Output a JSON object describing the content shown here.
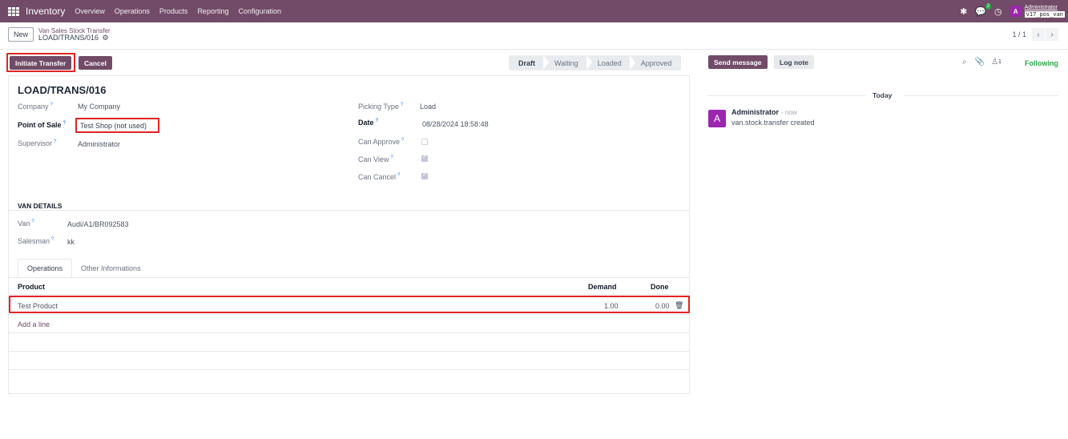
{
  "navbar": {
    "app_name": "Inventory",
    "menus": [
      "Overview",
      "Operations",
      "Products",
      "Reporting",
      "Configuration"
    ],
    "message_count": "2",
    "user_initial": "A",
    "user_name": "Administrator",
    "database": "v17_pos_van"
  },
  "control": {
    "new_label": "New",
    "breadcrumb_parent": "Van Sales Stock Transfer",
    "breadcrumb_current": "LOAD/TRANS/016",
    "pager": "1 / 1"
  },
  "actions": {
    "initiate_label": "Initiate Transfer",
    "cancel_label": "Cancel"
  },
  "status": {
    "stages": [
      "Draft",
      "Waiting",
      "Loaded",
      "Approved"
    ],
    "active": "Draft"
  },
  "form": {
    "title": "LOAD/TRANS/016",
    "company_label": "Company",
    "company_value": "My Company",
    "pos_label": "Point of Sale",
    "pos_value": "Test Shop (not used)",
    "supervisor_label": "Supervisor",
    "supervisor_value": "Administrator",
    "picking_type_label": "Picking Type",
    "picking_type_value": "Load",
    "date_label": "Date",
    "date_value": "08/28/2024 18:58:48",
    "can_approve_label": "Can Approve",
    "can_view_label": "Can View",
    "can_cancel_label": "Can Cancel",
    "help_mark": "?",
    "van_section": "VAN DETAILS",
    "van_label": "Van",
    "van_value": "Audi/A1/BR092583",
    "salesman_label": "Salesman",
    "salesman_value": "kk",
    "tabs": [
      "Operations",
      "Other Informations"
    ],
    "table": {
      "headers": [
        "Product",
        "Demand",
        "Done"
      ],
      "rows": [
        {
          "product": "Test Product",
          "demand": "1.00",
          "done": "0.00"
        }
      ],
      "add_line": "Add a line"
    }
  },
  "chatter": {
    "send_message": "Send message",
    "log_note": "Log note",
    "followers_count": "1",
    "following": "Following",
    "today": "Today",
    "author": "Administrator",
    "time": "- now",
    "body": "van.stock.transfer created",
    "avatar_initial": "A"
  },
  "colors": {
    "brand": "#714b67",
    "highlight": "#e02424",
    "following": "#28a745"
  }
}
